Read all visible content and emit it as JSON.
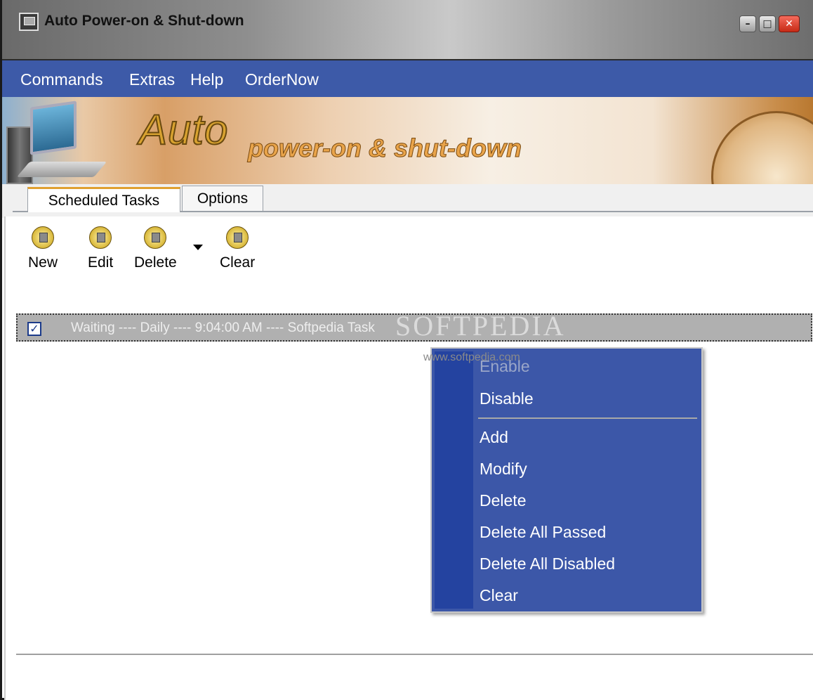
{
  "window": {
    "title": "Auto Power-on & Shut-down",
    "controls": [
      "minimize",
      "maximize",
      "close"
    ]
  },
  "menu": [
    "Commands",
    "Extras",
    "Help",
    "OrderNow"
  ],
  "banner": {
    "title": "Auto",
    "subtitle": "power-on & shut-down"
  },
  "tabs": [
    {
      "label": "Scheduled Tasks",
      "active": true
    },
    {
      "label": "Options",
      "active": false
    }
  ],
  "toolbar": [
    {
      "label": "New",
      "icon": "new-task-icon"
    },
    {
      "label": "Edit",
      "icon": "edit-icon"
    },
    {
      "label": "Delete",
      "icon": "delete-icon"
    },
    {
      "label": "Clear",
      "icon": "eraser-icon"
    }
  ],
  "tasks": [
    {
      "checked": true,
      "text": "Waiting ---- Daily ---- 9:04:00 AM ---- Softpedia Task"
    }
  ],
  "watermark": {
    "brand": "SOFTPEDIA",
    "url": "www.softpedia.com"
  },
  "context_menu": [
    {
      "label": "Enable",
      "enabled": false
    },
    {
      "label": "Disable",
      "enabled": true
    },
    {
      "label": "Add",
      "enabled": true
    },
    {
      "label": "Modify",
      "enabled": true
    },
    {
      "label": "Delete",
      "enabled": true
    },
    {
      "label": "Delete All Passed",
      "enabled": true
    },
    {
      "label": "Delete All Disabled",
      "enabled": true
    },
    {
      "label": "Clear",
      "enabled": true
    }
  ],
  "colors": {
    "menubar": "#3d5aa8",
    "context_menu": "#3c57a8",
    "context_gutter": "#2443a0",
    "selected_row": "#b0b0b0"
  }
}
